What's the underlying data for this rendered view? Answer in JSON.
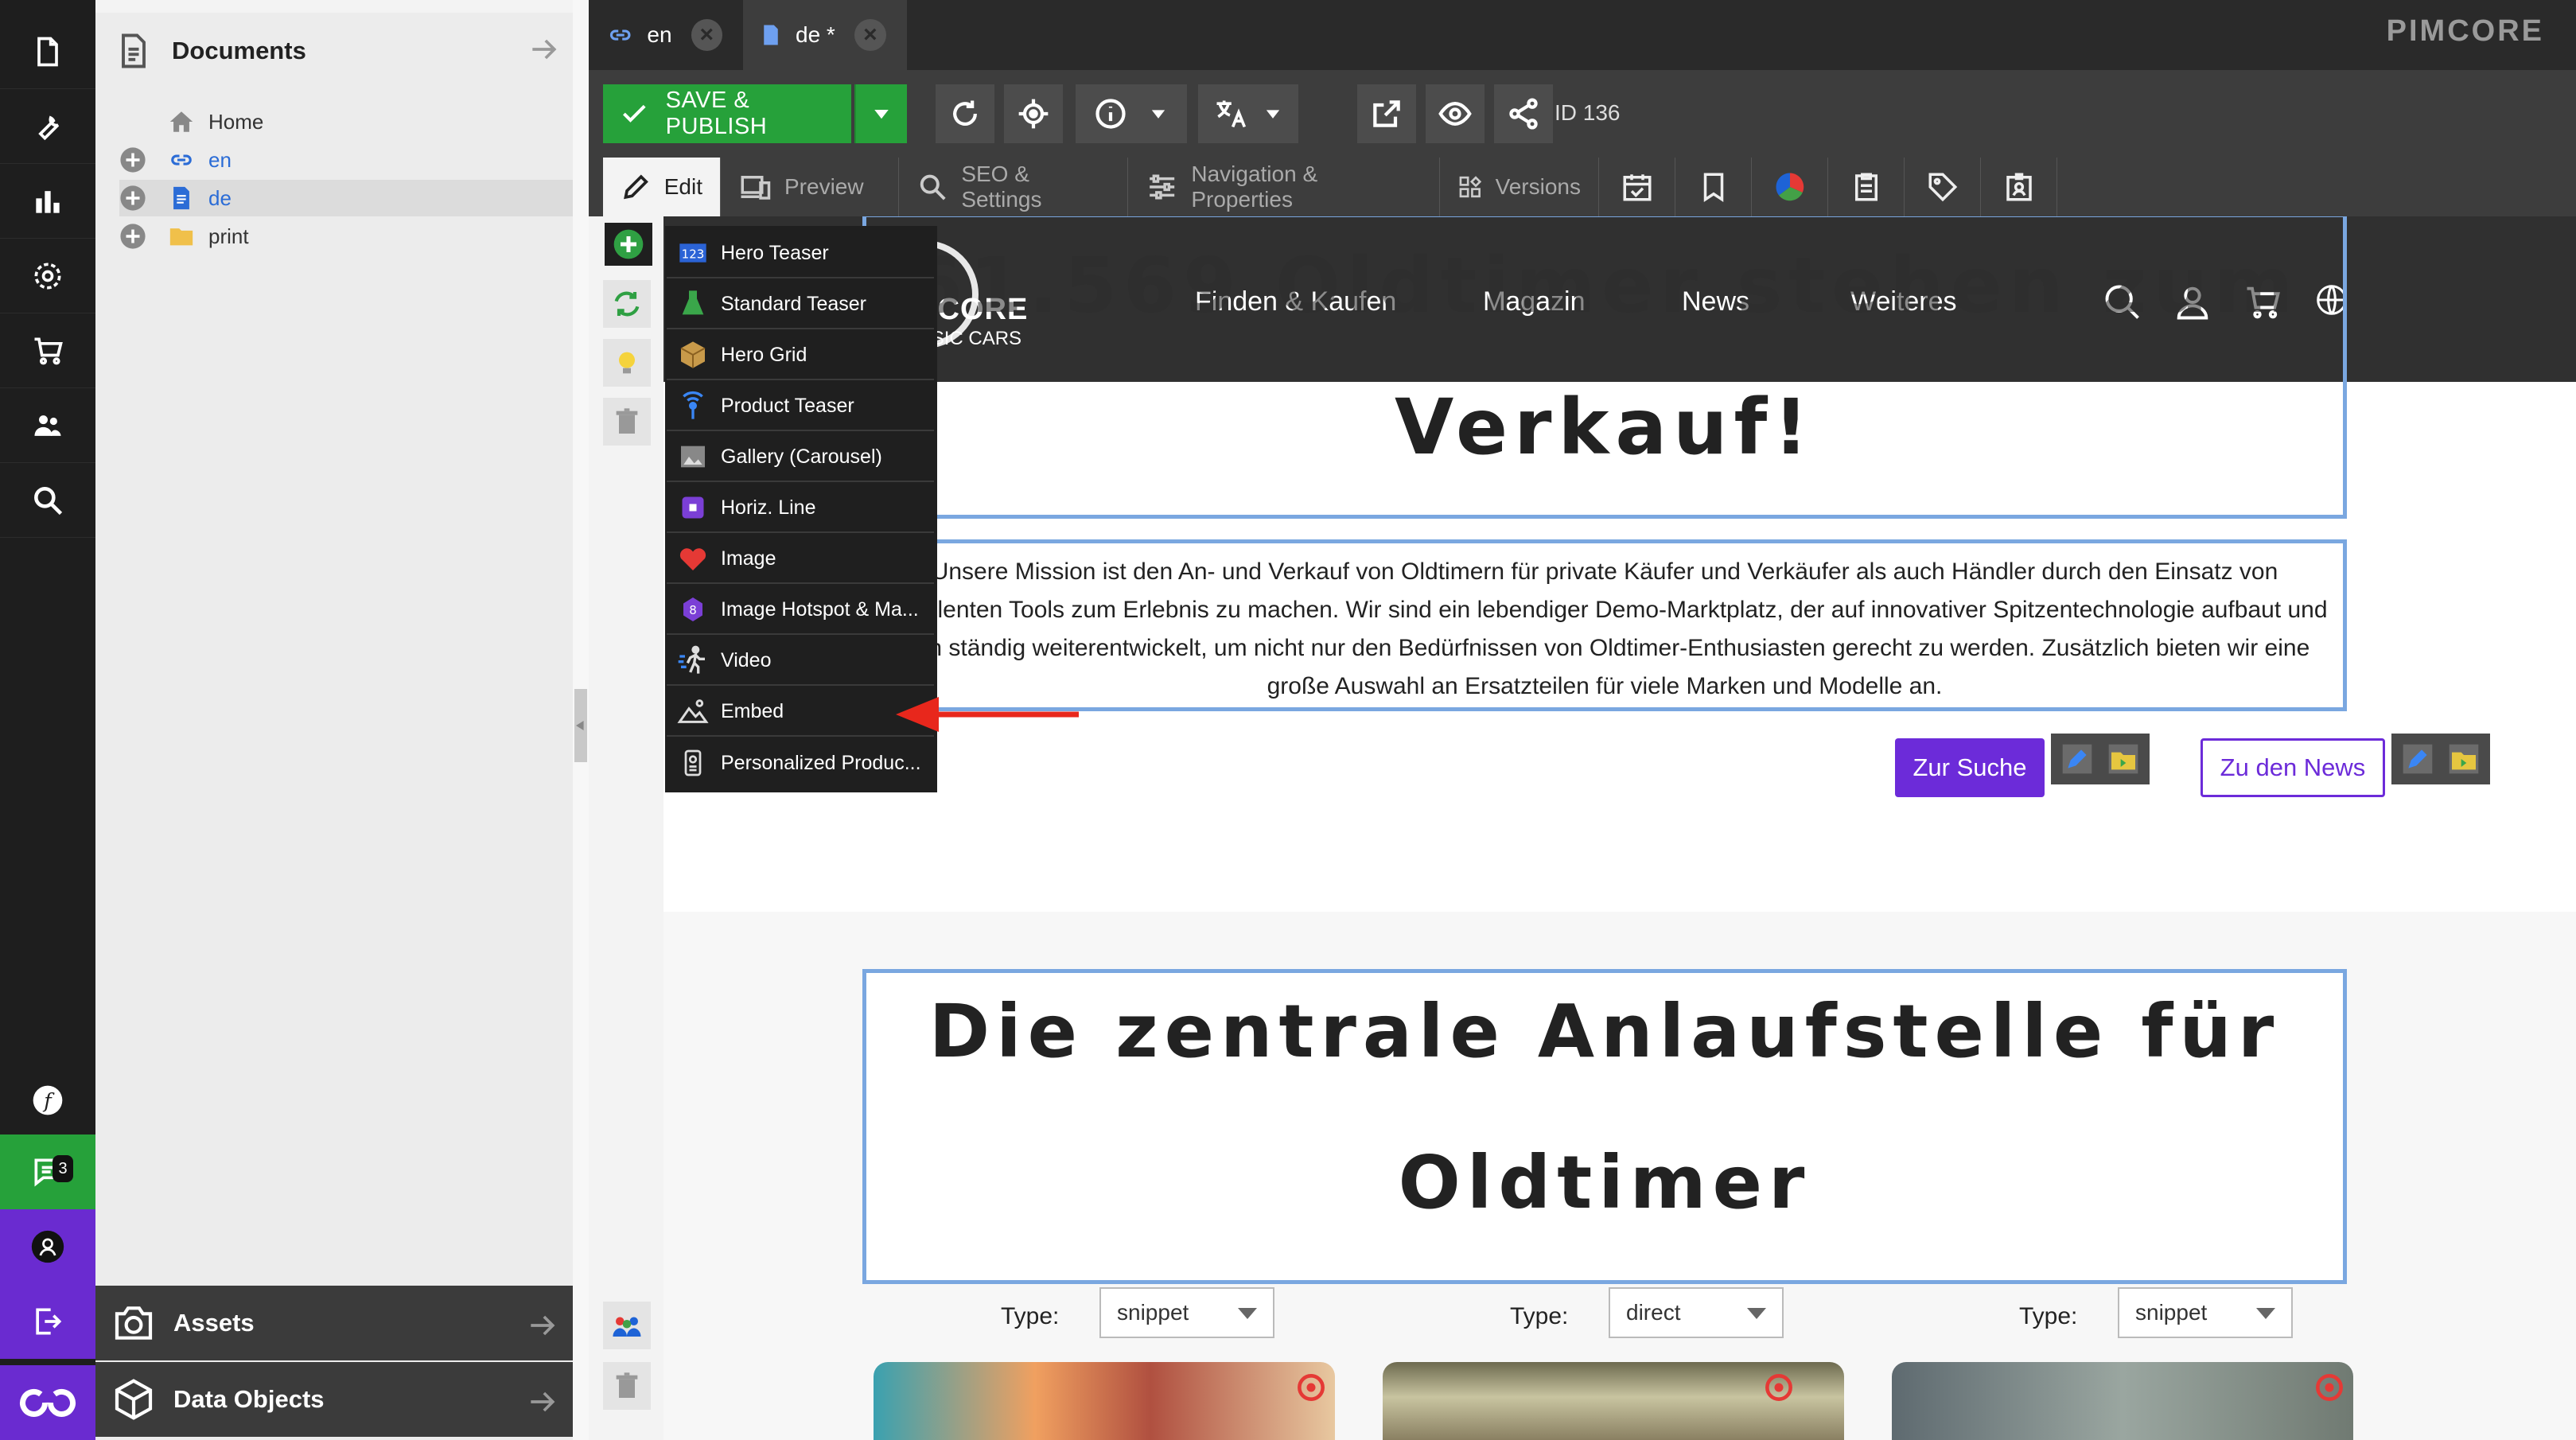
{
  "rail": {
    "items": [
      "document-icon",
      "wrench-icon",
      "chart-icon",
      "gear-icon",
      "cart-icon",
      "users-icon",
      "search-icon"
    ],
    "bottom": {
      "chat_badge": "3"
    }
  },
  "tree": {
    "title": "Documents",
    "items": [
      {
        "label": "Home",
        "color": "#333333"
      },
      {
        "label": "en",
        "color": "#2b6cd6"
      },
      {
        "label": "de",
        "color": "#2b6cd6"
      },
      {
        "label": "print",
        "color": "#333333"
      }
    ]
  },
  "bottom_panels": {
    "assets": "Assets",
    "data_objects": "Data Objects"
  },
  "tabs": [
    {
      "label": "en"
    },
    {
      "label": "de *"
    }
  ],
  "brand": "PIMCORE",
  "toolbar": {
    "save_publish": "SAVE & PUBLISH",
    "doc_id": "ID 136"
  },
  "edit_tabs": {
    "edit": "Edit",
    "preview": "Preview",
    "seo": "SEO & Settings",
    "navigation": "Navigation & Properties",
    "versions": "Versions"
  },
  "block_menu": {
    "items": [
      {
        "label": "Hero Teaser",
        "icon": "numbers-icon"
      },
      {
        "label": "Standard Teaser",
        "icon": "flask-icon"
      },
      {
        "label": "Hero Grid",
        "icon": "box-icon"
      },
      {
        "label": "Product Teaser",
        "icon": "broadcast-icon"
      },
      {
        "label": "Gallery (Carousel)",
        "icon": "gallery-icon"
      },
      {
        "label": "Horiz. Line",
        "icon": "line-icon"
      },
      {
        "label": "Image",
        "icon": "heart-icon"
      },
      {
        "label": "Image Hotspot & Ma...",
        "icon": "hotspot-icon"
      },
      {
        "label": "Video",
        "icon": "run-icon"
      },
      {
        "label": "Embed",
        "icon": "landscape-icon"
      },
      {
        "label": "Personalized Produc...",
        "icon": "phone-icon"
      }
    ]
  },
  "site": {
    "logo_title": "PIMCORE",
    "logo_subtitle": "CLASSIC CARS",
    "nav": [
      "Finden & Kaufen",
      "Magazin",
      "News",
      "Weiteres"
    ],
    "headline_1": "61.569 Oldtimer stehen zum",
    "headline_2": "Verkauf!",
    "mission": "Unsere Mission ist den An- und Verkauf von Oldtimern für private Käufer und Verkäufer als auch Händler durch den Einsatz von exzellenten Tools zum Erlebnis zu machen. Wir sind ein lebendiger Demo-Marktplatz, der auf innovativer Spitzentechnologie aufbaut und sich ständig weiterentwickelt, um nicht nur den Bedürfnissen von Oldtimer-Enthusiasten gerecht zu werden. Zusätzlich bieten wir eine große Auswahl an Ersatzteilen für viele Marken und Modelle an.",
    "btn_search": "Zur Suche",
    "btn_news": "Zu den News",
    "section2_line1": "Die zentrale Anlaufstelle für",
    "section2_line2": "Oldtimer",
    "type_label": "Type:",
    "selects": [
      "snippet",
      "direct",
      "snippet"
    ]
  },
  "colors": {
    "accent_green": "#26a13a",
    "purple": "#6c2bd9",
    "editable_border": "#7aa7e0"
  }
}
